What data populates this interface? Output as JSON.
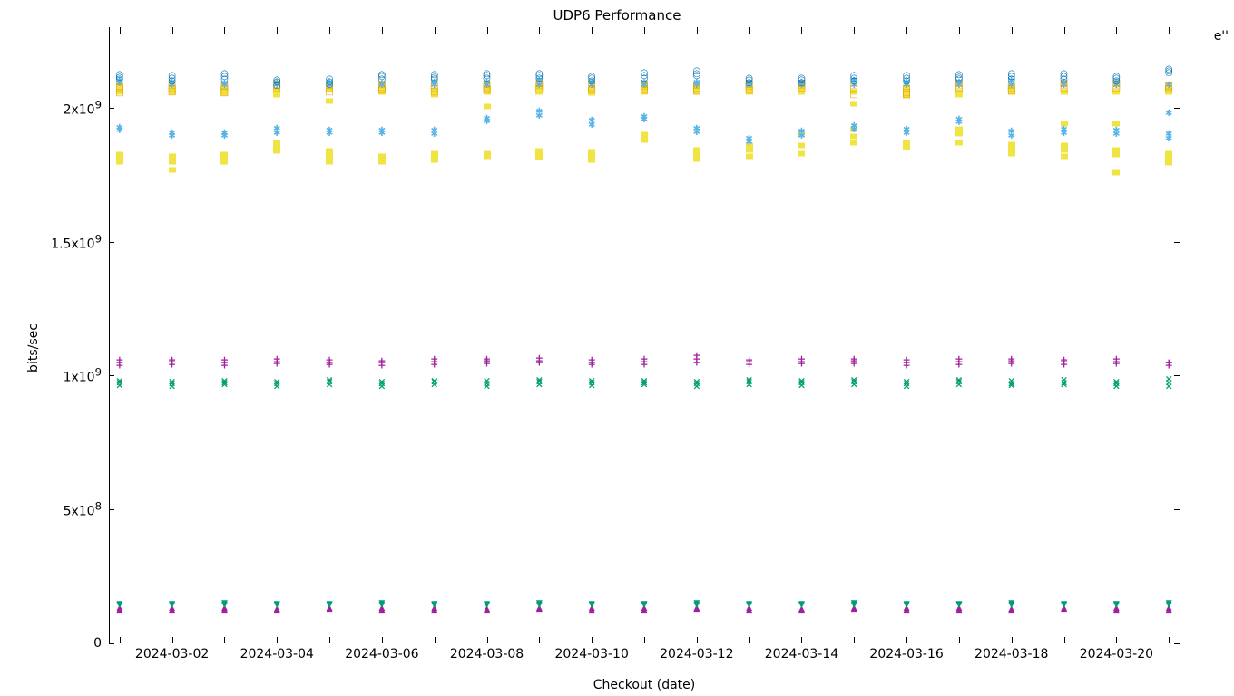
{
  "chart_data": {
    "type": "scatter",
    "title": "UDP6 Performance",
    "xlabel": "Checkout (date)",
    "ylabel": "bits/sec",
    "corner_label": "e''",
    "ylim": [
      0,
      2300000000
    ],
    "yticks": [
      {
        "value": 0,
        "label": "0"
      },
      {
        "value": 500000000,
        "label": "5x10^8"
      },
      {
        "value": 1000000000,
        "label": "1x10^9"
      },
      {
        "value": 1500000000,
        "label": "1.5x10^9"
      },
      {
        "value": 2000000000,
        "label": "2x10^9"
      }
    ],
    "xticks_labeled": [
      "2024-03-02",
      "2024-03-04",
      "2024-03-06",
      "2024-03-08",
      "2024-03-10",
      "2024-03-12",
      "2024-03-14",
      "2024-03-16",
      "2024-03-18",
      "2024-03-20"
    ],
    "x_categories": [
      "2024-03-01",
      "2024-03-02",
      "2024-03-03",
      "2024-03-04",
      "2024-03-05",
      "2024-03-06",
      "2024-03-07",
      "2024-03-08",
      "2024-03-09",
      "2024-03-10",
      "2024-03-11",
      "2024-03-12",
      "2024-03-13",
      "2024-03-14",
      "2024-03-15",
      "2024-03-16",
      "2024-03-17",
      "2024-03-18",
      "2024-03-19",
      "2024-03-20",
      "2024-03-21"
    ],
    "series": [
      {
        "name": "series-low-magenta-up",
        "glyph": "up",
        "color": "magenta",
        "y_per_day": [
          [
            130000000,
            135000000
          ],
          [
            128000000,
            134000000
          ],
          [
            130000000,
            136000000
          ],
          [
            129000000,
            133000000
          ],
          [
            131000000,
            135000000
          ],
          [
            130000000,
            134000000
          ],
          [
            129000000,
            136000000
          ],
          [
            128000000,
            133000000
          ],
          [
            131000000,
            135000000
          ],
          [
            130000000,
            134000000
          ],
          [
            129000000,
            136000000
          ],
          [
            131000000,
            135000000
          ],
          [
            130000000,
            134000000
          ],
          [
            128000000,
            133000000
          ],
          [
            131000000,
            136000000
          ],
          [
            129000000,
            134000000
          ],
          [
            130000000,
            135000000
          ],
          [
            128000000,
            133000000
          ],
          [
            131000000,
            136000000
          ],
          [
            130000000,
            134000000
          ],
          [
            129000000,
            135000000
          ]
        ]
      },
      {
        "name": "series-low-teal-dn",
        "glyph": "dn",
        "color": "teal",
        "y_per_day": [
          [
            145000000,
            150000000
          ],
          [
            144000000,
            149000000
          ],
          [
            146000000,
            151000000
          ],
          [
            145000000,
            150000000
          ],
          [
            144000000,
            149000000
          ],
          [
            146000000,
            151000000
          ],
          [
            145000000,
            150000000
          ],
          [
            144000000,
            149000000
          ],
          [
            146000000,
            151000000
          ],
          [
            145000000,
            150000000
          ],
          [
            144000000,
            149000000
          ],
          [
            146000000,
            151000000
          ],
          [
            145000000,
            150000000
          ],
          [
            144000000,
            149000000
          ],
          [
            146000000,
            151000000
          ],
          [
            145000000,
            150000000
          ],
          [
            144000000,
            149000000
          ],
          [
            146000000,
            151000000
          ],
          [
            145000000,
            150000000
          ],
          [
            144000000,
            149000000
          ],
          [
            146000000,
            151000000
          ]
        ]
      },
      {
        "name": "series-mid-teal-x",
        "glyph": "x",
        "color": "teal",
        "y_per_day": [
          [
            965000000,
            975000000,
            980000000
          ],
          [
            960000000,
            972000000,
            978000000
          ],
          [
            968000000,
            975000000,
            982000000
          ],
          [
            962000000,
            971000000,
            979000000
          ],
          [
            967000000,
            976000000,
            983000000
          ],
          [
            960000000,
            970000000,
            978000000
          ],
          [
            968000000,
            976000000,
            982000000
          ],
          [
            961000000,
            972000000,
            980000000
          ],
          [
            969000000,
            977000000,
            983000000
          ],
          [
            963000000,
            973000000,
            981000000
          ],
          [
            966000000,
            975000000,
            982000000
          ],
          [
            962000000,
            971000000,
            979000000
          ],
          [
            968000000,
            977000000,
            984000000
          ],
          [
            964000000,
            973000000,
            981000000
          ],
          [
            967000000,
            976000000,
            983000000
          ],
          [
            961000000,
            970000000,
            978000000
          ],
          [
            969000000,
            978000000,
            985000000
          ],
          [
            963000000,
            972000000,
            980000000
          ],
          [
            966000000,
            975000000,
            983000000
          ],
          [
            962000000,
            971000000,
            979000000
          ],
          [
            960000000,
            989000000,
            974000000
          ]
        ]
      },
      {
        "name": "series-mid-magenta-plus",
        "glyph": "plus",
        "color": "magenta",
        "y_per_day": [
          [
            1040000000,
            1050000000,
            1060000000
          ],
          [
            1042000000,
            1051000000,
            1058000000
          ],
          [
            1039000000,
            1049000000,
            1057000000
          ],
          [
            1044000000,
            1053000000,
            1062000000
          ],
          [
            1041000000,
            1050000000,
            1060000000
          ],
          [
            1038000000,
            1048000000,
            1056000000
          ],
          [
            1043000000,
            1052000000,
            1061000000
          ],
          [
            1045000000,
            1054000000,
            1063000000
          ],
          [
            1047000000,
            1056000000,
            1065000000
          ],
          [
            1041000000,
            1050000000,
            1059000000
          ],
          [
            1043000000,
            1052000000,
            1061000000
          ],
          [
            1050000000,
            1062000000,
            1075000000
          ],
          [
            1042000000,
            1051000000,
            1059000000
          ],
          [
            1044000000,
            1053000000,
            1062000000
          ],
          [
            1046000000,
            1055000000,
            1063000000
          ],
          [
            1040000000,
            1049000000,
            1058000000
          ],
          [
            1043000000,
            1052000000,
            1061000000
          ],
          [
            1045000000,
            1054000000,
            1062000000
          ],
          [
            1042000000,
            1051000000,
            1060000000
          ],
          [
            1044000000,
            1053000000,
            1062000000
          ],
          [
            1038000000,
            1047000000,
            1049000000
          ]
        ]
      },
      {
        "name": "series-hi-yellow-fsq",
        "glyph": "fsq",
        "color": "yellow",
        "y_per_day": [
          [
            1800000000,
            1810000000,
            1825000000,
            2060000000,
            2080000000
          ],
          [
            1770000000,
            1800000000,
            1820000000,
            2060000000,
            2075000000
          ],
          [
            1800000000,
            1805000000,
            1825000000,
            2055000000,
            2070000000
          ],
          [
            1840000000,
            1860000000,
            1870000000,
            2050000000,
            2065000000
          ],
          [
            1800000000,
            1820000000,
            1840000000,
            2025000000,
            2075000000
          ],
          [
            1800000000,
            1805000000,
            1820000000,
            2060000000,
            2070000000
          ],
          [
            1805000000,
            1815000000,
            1830000000,
            2050000000,
            2065000000
          ],
          [
            1820000000,
            1830000000,
            2005000000,
            2060000000,
            2075000000
          ],
          [
            1815000000,
            1825000000,
            1840000000,
            2060000000,
            2080000000
          ],
          [
            1805000000,
            1820000000,
            1835000000,
            2055000000,
            2070000000
          ],
          [
            1880000000,
            1900000000,
            2060000000,
            2075000000,
            2090000000
          ],
          [
            1810000000,
            1830000000,
            1845000000,
            2060000000,
            2080000000
          ],
          [
            1820000000,
            1845000000,
            1860000000,
            2060000000,
            2075000000
          ],
          [
            1830000000,
            1860000000,
            1905000000,
            2060000000,
            2075000000
          ],
          [
            1870000000,
            1895000000,
            1920000000,
            2015000000,
            2060000000
          ],
          [
            1855000000,
            1870000000,
            2045000000,
            2060000000,
            2075000000
          ],
          [
            1870000000,
            1905000000,
            1920000000,
            2060000000,
            2050000000
          ],
          [
            1830000000,
            1850000000,
            1865000000,
            2060000000,
            2075000000
          ],
          [
            1820000000,
            1845000000,
            1860000000,
            1940000000,
            2060000000
          ],
          [
            1760000000,
            1825000000,
            1845000000,
            1940000000,
            2060000000
          ],
          [
            1795000000,
            1815000000,
            1830000000,
            2060000000,
            2075000000
          ]
        ]
      },
      {
        "name": "series-hi-skyblue-ast",
        "glyph": "ast",
        "color": "skyblue",
        "y_per_day": [
          [
            1915000000,
            1925000000,
            2090000000,
            2100000000
          ],
          [
            1895000000,
            1905000000,
            2085000000,
            2095000000
          ],
          [
            1895000000,
            1905000000,
            2085000000,
            2090000000
          ],
          [
            1905000000,
            1920000000,
            2085000000,
            2095000000
          ],
          [
            1905000000,
            1915000000,
            2085000000,
            2095000000
          ],
          [
            1905000000,
            1915000000,
            2085000000,
            2090000000
          ],
          [
            1900000000,
            1915000000,
            2085000000,
            2095000000
          ],
          [
            1948000000,
            1960000000,
            2085000000,
            2095000000
          ],
          [
            1970000000,
            1985000000,
            2085000000,
            2100000000
          ],
          [
            1935000000,
            1950000000,
            2085000000,
            2095000000
          ],
          [
            1955000000,
            1965000000,
            2085000000,
            2095000000
          ],
          [
            1908000000,
            1920000000,
            2085000000,
            2095000000
          ],
          [
            1870000000,
            1885000000,
            2085000000,
            2095000000
          ],
          [
            1895000000,
            1910000000,
            2085000000,
            2095000000
          ],
          [
            1918000000,
            1930000000,
            2085000000,
            2100000000
          ],
          [
            1905000000,
            1918000000,
            2085000000,
            2095000000
          ],
          [
            1945000000,
            1955000000,
            2085000000,
            2095000000
          ],
          [
            1895000000,
            1910000000,
            2085000000,
            2100000000
          ],
          [
            1905000000,
            1918000000,
            2085000000,
            2095000000
          ],
          [
            1900000000,
            1915000000,
            2085000000,
            2095000000
          ],
          [
            1885000000,
            1900000000,
            1980000000,
            2085000000
          ]
        ]
      },
      {
        "name": "series-hi-orange-osq",
        "glyph": "osq",
        "color": "orange",
        "y_per_day": [
          [
            2055000000,
            2075000000,
            2080000000
          ],
          [
            2060000000,
            2072000000,
            2085000000
          ],
          [
            2058000000,
            2070000000,
            2083000000
          ],
          [
            2075000000,
            2082000000,
            2088000000
          ],
          [
            2060000000,
            2075000000,
            2085000000
          ],
          [
            2065000000,
            2078000000,
            2086000000
          ],
          [
            2060000000,
            2072000000,
            2083000000
          ],
          [
            2065000000,
            2078000000,
            2088000000
          ],
          [
            2070000000,
            2082000000,
            2090000000
          ],
          [
            2065000000,
            2078000000,
            2086000000
          ],
          [
            2068000000,
            2080000000,
            2088000000
          ],
          [
            2062000000,
            2074000000,
            2084000000
          ],
          [
            2068000000,
            2080000000,
            2088000000
          ],
          [
            2072000000,
            2082000000,
            2090000000
          ],
          [
            2050000000,
            2070000000,
            2082000000
          ],
          [
            2058000000,
            2072000000,
            2050000000
          ],
          [
            2075000000,
            2085000000,
            2090000000
          ],
          [
            2062000000,
            2074000000,
            2084000000
          ],
          [
            2075000000,
            2085000000,
            2090000000
          ],
          [
            2075000000,
            2085000000,
            2090000000
          ],
          [
            2080000000,
            2072000000,
            2085000000
          ]
        ]
      },
      {
        "name": "series-hi-blue-circ",
        "glyph": "circ",
        "color": "blue",
        "y_per_day": [
          [
            2106000000,
            2115000000,
            2125000000
          ],
          [
            2100000000,
            2112000000,
            2120000000
          ],
          [
            2108000000,
            2118000000,
            2128000000
          ],
          [
            2085000000,
            2096000000,
            2105000000
          ],
          [
            2088000000,
            2098000000,
            2106000000
          ],
          [
            2108000000,
            2116000000,
            2125000000
          ],
          [
            2106000000,
            2115000000,
            2123000000
          ],
          [
            2112000000,
            2122000000,
            2128000000
          ],
          [
            2112000000,
            2122000000,
            2128000000
          ],
          [
            2100000000,
            2110000000,
            2118000000
          ],
          [
            2112000000,
            2122000000,
            2130000000
          ],
          [
            2120000000,
            2128000000,
            2136000000
          ],
          [
            2095000000,
            2105000000,
            2112000000
          ],
          [
            2095000000,
            2105000000,
            2112000000
          ],
          [
            2100000000,
            2112000000,
            2120000000
          ],
          [
            2100000000,
            2112000000,
            2120000000
          ],
          [
            2106000000,
            2115000000,
            2125000000
          ],
          [
            2108000000,
            2118000000,
            2128000000
          ],
          [
            2108000000,
            2118000000,
            2128000000
          ],
          [
            2100000000,
            2110000000,
            2118000000
          ],
          [
            2130000000,
            2136000000,
            2144000000
          ]
        ]
      }
    ]
  }
}
